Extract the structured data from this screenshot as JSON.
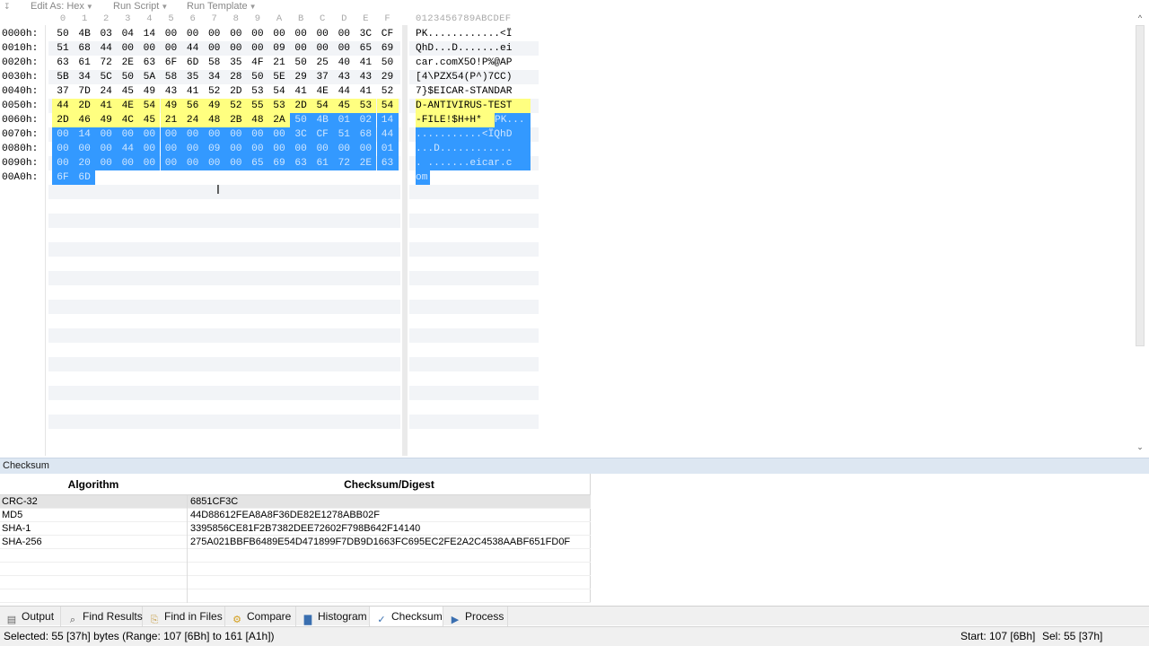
{
  "toolbar": {
    "overflow_icon": "menu-overflow-icon",
    "items": [
      {
        "label": "Edit As: Hex"
      },
      {
        "label": "Run Script"
      },
      {
        "label": "Run Template"
      }
    ]
  },
  "hex": {
    "column_headers": [
      "0",
      "1",
      "2",
      "3",
      "4",
      "5",
      "6",
      "7",
      "8",
      "9",
      "A",
      "B",
      "C",
      "D",
      "E",
      "F"
    ],
    "ascii_header": "0123456789ABCDEF",
    "rows": [
      {
        "offset": "0000h:",
        "bytes": [
          "50",
          "4B",
          "03",
          "04",
          "14",
          "00",
          "00",
          "00",
          "00",
          "00",
          "00",
          "00",
          "00",
          "00",
          "3C",
          "CF"
        ],
        "ascii": "PK............<Ï"
      },
      {
        "offset": "0010h:",
        "bytes": [
          "51",
          "68",
          "44",
          "00",
          "00",
          "00",
          "44",
          "00",
          "00",
          "00",
          "09",
          "00",
          "00",
          "00",
          "65",
          "69"
        ],
        "ascii": "QhD...D.......ei"
      },
      {
        "offset": "0020h:",
        "bytes": [
          "63",
          "61",
          "72",
          "2E",
          "63",
          "6F",
          "6D",
          "58",
          "35",
          "4F",
          "21",
          "50",
          "25",
          "40",
          "41",
          "50"
        ],
        "ascii": "car.comX5O!P%@AP"
      },
      {
        "offset": "0030h:",
        "bytes": [
          "5B",
          "34",
          "5C",
          "50",
          "5A",
          "58",
          "35",
          "34",
          "28",
          "50",
          "5E",
          "29",
          "37",
          "43",
          "43",
          "29"
        ],
        "ascii": "[4\\PZX54(P^)7CC)"
      },
      {
        "offset": "0040h:",
        "bytes": [
          "37",
          "7D",
          "24",
          "45",
          "49",
          "43",
          "41",
          "52",
          "2D",
          "53",
          "54",
          "41",
          "4E",
          "44",
          "41",
          "52"
        ],
        "ascii": "7}$EICAR-STANDAR"
      },
      {
        "offset": "0050h:",
        "bytes": [
          "44",
          "2D",
          "41",
          "4E",
          "54",
          "49",
          "56",
          "49",
          "52",
          "55",
          "53",
          "2D",
          "54",
          "45",
          "53",
          "54"
        ],
        "ascii": "D-ANTIVIRUS-TEST"
      },
      {
        "offset": "0060h:",
        "bytes": [
          "2D",
          "46",
          "49",
          "4C",
          "45",
          "21",
          "24",
          "48",
          "2B",
          "48",
          "2A",
          "50",
          "4B",
          "01",
          "02",
          "14"
        ],
        "ascii": "-FILE!$H+H*PK..."
      },
      {
        "offset": "0070h:",
        "bytes": [
          "00",
          "14",
          "00",
          "00",
          "00",
          "00",
          "00",
          "00",
          "00",
          "00",
          "00",
          "3C",
          "CF",
          "51",
          "68",
          "44"
        ],
        "ascii": "...........<ÏQhD"
      },
      {
        "offset": "0080h:",
        "bytes": [
          "00",
          "00",
          "00",
          "44",
          "00",
          "00",
          "00",
          "09",
          "00",
          "00",
          "00",
          "00",
          "00",
          "00",
          "00",
          "01"
        ],
        "ascii": "...D............"
      },
      {
        "offset": "0090h:",
        "bytes": [
          "00",
          "20",
          "00",
          "00",
          "00",
          "00",
          "00",
          "00",
          "00",
          "65",
          "69",
          "63",
          "61",
          "72",
          "2E",
          "63"
        ],
        "ascii": ". .......eicar.c"
      },
      {
        "offset": "00A0h:",
        "bytes": [
          "6F",
          "6D"
        ],
        "ascii": "om"
      }
    ],
    "highlight": {
      "eicar_color": "#ffff80",
      "selection_color": "#3399ff"
    }
  },
  "checksum_panel": {
    "title": "Checksum",
    "columns": [
      "Algorithm",
      "Checksum/Digest"
    ],
    "rows": [
      {
        "algorithm": "CRC-32",
        "digest": "6851CF3C"
      },
      {
        "algorithm": "MD5",
        "digest": "44D88612FEA8A8F36DE82E1278ABB02F"
      },
      {
        "algorithm": "SHA-1",
        "digest": "3395856CE81F2B7382DEE72602F798B642F14140"
      },
      {
        "algorithm": "SHA-256",
        "digest": "275A021BBFB6489E54D471899F7DB9D1663FC695EC2FE2A2C4538AABF651FD0F"
      }
    ]
  },
  "tabs": [
    {
      "label": "Output",
      "icon": "output-icon"
    },
    {
      "label": "Find Results",
      "icon": "search-icon"
    },
    {
      "label": "Find in Files",
      "icon": "folder-search-icon"
    },
    {
      "label": "Compare",
      "icon": "compare-icon"
    },
    {
      "label": "Histogram",
      "icon": "histogram-icon"
    },
    {
      "label": "Checksum",
      "icon": "checksum-icon"
    },
    {
      "label": "Process",
      "icon": "process-icon"
    }
  ],
  "active_tab": "Checksum",
  "status": {
    "selected": "Selected: 55 [37h] bytes (Range: 107 [6Bh] to 161 [A1h])",
    "start": "Start: 107 [6Bh]",
    "sel": "Sel: 55 [37h]"
  }
}
